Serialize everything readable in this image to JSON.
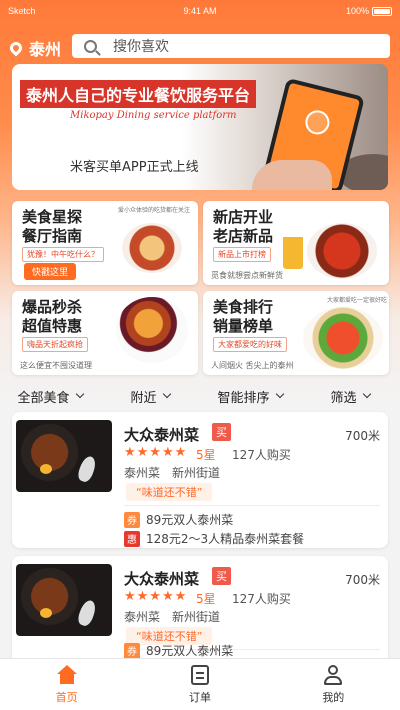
{
  "status": {
    "carrier": "Sketch",
    "time": "9:41 AM",
    "battery": "100%"
  },
  "header": {
    "city": "泰州",
    "search_placeholder": "搜你喜欢"
  },
  "banner": {
    "title": "泰州人自己的专业餐饮服务平台",
    "subtitle_en": "Mikopay Dining service platform",
    "subtitle_cn": "米客买单APP正式上线"
  },
  "cards": [
    {
      "line1": "美食星探",
      "line2": "餐厅指南",
      "note": "爱小众体验的吃货都在关注",
      "tag": "犹豫！中午吃什么？",
      "button": "快戳这里"
    },
    {
      "line1": "新店开业",
      "line2": "老店新品",
      "tag": "新品上市打榜",
      "caption": "觅食就想尝点新鲜货"
    },
    {
      "line1": "爆品秒杀",
      "line2": "超值特惠",
      "tag": "嗨品天折起疯抢",
      "caption": "这么便宜不囤没道理"
    },
    {
      "line1": "美食排行",
      "line2": "销量榜单",
      "note": "大家都爱吃一定很好吃",
      "tag": "大家都爱吃的好味",
      "caption": "人间烟火 舌尖上的泰州"
    }
  ],
  "filters": [
    "全部美食",
    "附近",
    "智能排序",
    "筛选"
  ],
  "listings": [
    {
      "name": "大众泰州菜",
      "buy_badge": "买",
      "distance": "700米",
      "stars": "★★★★★",
      "rating": "5星",
      "sold": "127人购买",
      "category": "泰州菜",
      "street": "新州街道",
      "quote": "“味道还不错”",
      "deals": [
        {
          "icon": "券",
          "text": "89元双人泰州菜"
        },
        {
          "icon": "惠",
          "text": "128元2～3人精品泰州菜套餐"
        }
      ]
    },
    {
      "name": "大众泰州菜",
      "buy_badge": "买",
      "distance": "700米",
      "stars": "★★★★★",
      "rating": "5星",
      "sold": "127人购买",
      "category": "泰州菜",
      "street": "新州街道",
      "quote": "“味道还不错”",
      "deals": [
        {
          "icon": "券",
          "text": "89元双人泰州菜"
        }
      ]
    }
  ],
  "tabbar": [
    "首页",
    "订单",
    "我的"
  ],
  "colors": {
    "accent": "#ff6b21",
    "deal_coupon": "#ff8a3d",
    "deal_discount": "#e8392f"
  }
}
